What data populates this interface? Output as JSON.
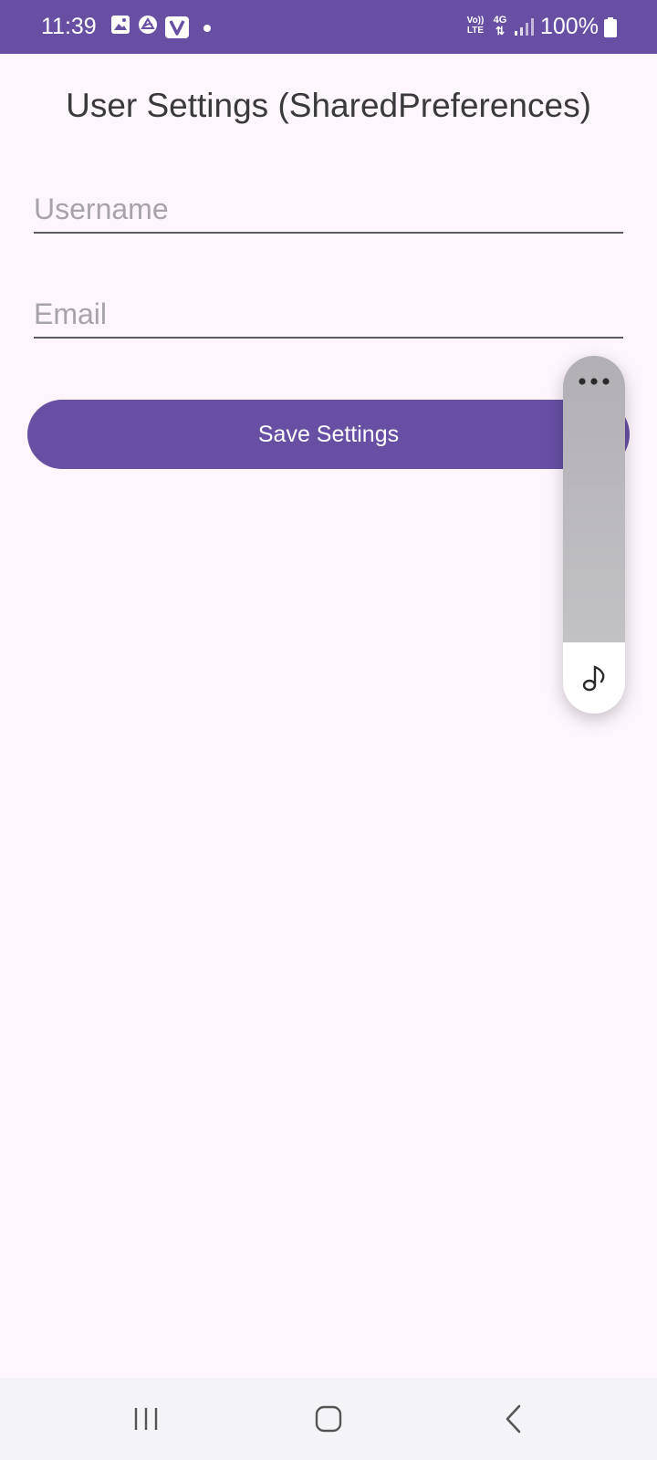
{
  "status_bar": {
    "time": "11:39",
    "icons": [
      "gallery-icon",
      "app-icon",
      "v-app-icon",
      "notification-dot"
    ],
    "volte_line1": "Vo))",
    "volte_line2": "LTE",
    "network_type": "4G",
    "battery_percent": "100%",
    "background_color": "#6750a4"
  },
  "page": {
    "title": "User Settings (SharedPreferences)"
  },
  "form": {
    "username_placeholder": "Username",
    "username_value": "",
    "email_placeholder": "Email",
    "email_value": "",
    "save_label": "Save Settings"
  },
  "floating_panel": {
    "top_icon": "more-horizontal-icon",
    "bottom_icon": "music-note-icon"
  },
  "navigation_bar": {
    "buttons": [
      "recent-apps-icon",
      "home-icon",
      "back-icon"
    ]
  },
  "colors": {
    "accent": "#6750a4",
    "background": "#fdf6fd"
  }
}
